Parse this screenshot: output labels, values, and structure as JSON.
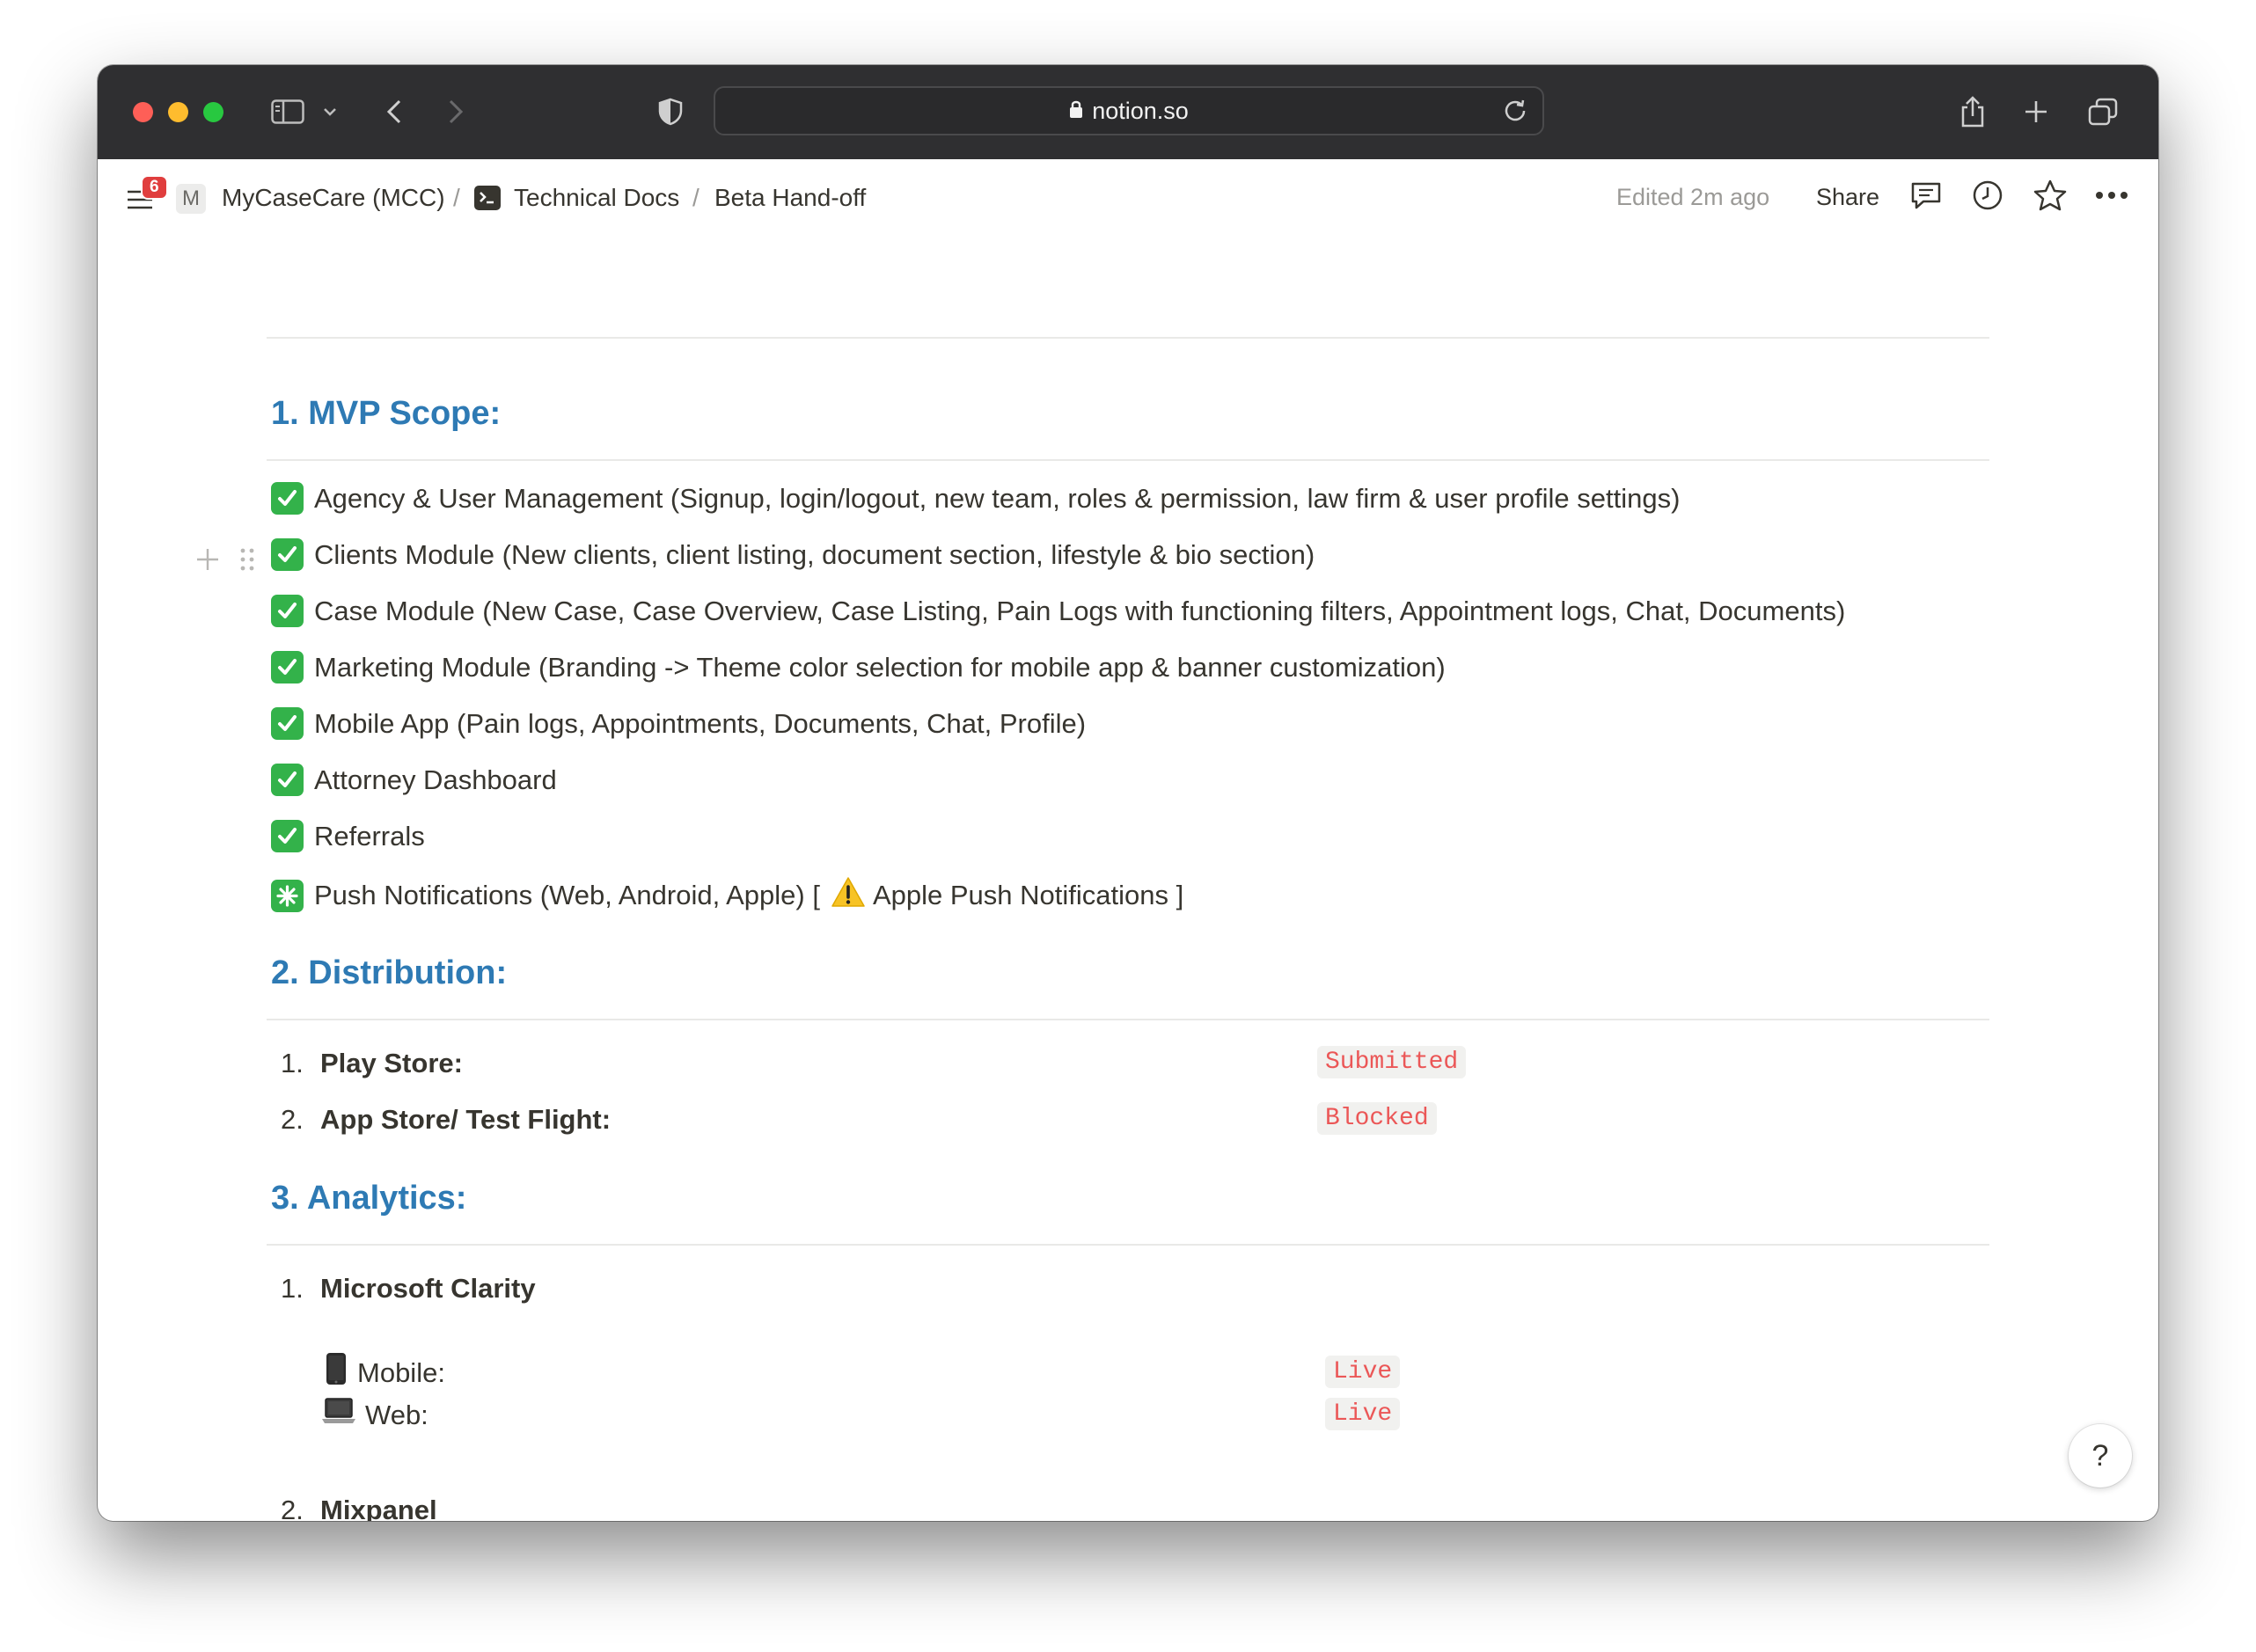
{
  "browser": {
    "url": "notion.so"
  },
  "topbar": {
    "notification_count": "6",
    "workspace_initial": "M",
    "breadcrumb": [
      "MyCaseCare (MCC)",
      "Technical Docs",
      "Beta Hand-off"
    ],
    "separator": "/",
    "edited": "Edited 2m ago",
    "share": "Share"
  },
  "sections": {
    "mvp": {
      "heading": "1. MVP Scope:",
      "items": [
        "Agency & User Management (Signup, login/logout, new team, roles & permission, law firm & user profile settings)",
        "Clients Module (New clients, client listing, document section, lifestyle & bio section)",
        "Case Module (New Case, Case Overview, Case Listing, Pain Logs with functioning filters, Appointment logs, Chat, Documents)",
        "Marketing Module (Branding -> Theme color selection for mobile app & banner customization)",
        "Mobile App (Pain logs, Appointments, Documents, Chat, Profile)",
        "Attorney Dashboard",
        "Referrals"
      ],
      "push_item_prefix": "Push Notifications (Web, Android, Apple) [",
      "push_item_warning": "Apple Push Notifications ]"
    },
    "distribution": {
      "heading": "2. Distribution:",
      "items": [
        {
          "num": "1.",
          "label": "Play Store:",
          "status": "Submitted"
        },
        {
          "num": "2.",
          "label": "App Store/ Test Flight:",
          "status": "Blocked"
        }
      ]
    },
    "analytics": {
      "heading": "3. Analytics:",
      "items": [
        {
          "num": "1.",
          "label": "Microsoft Clarity"
        },
        {
          "num": "2.",
          "label": "Mixpanel"
        }
      ],
      "clarity": [
        {
          "label": "Mobile:",
          "status": "Live"
        },
        {
          "label": "Web:",
          "status": "Live"
        }
      ]
    }
  },
  "help": "?",
  "colors": {
    "heading": "#2e7ab4",
    "tag_text": "#eb5757",
    "check_green": "#33b24a"
  }
}
